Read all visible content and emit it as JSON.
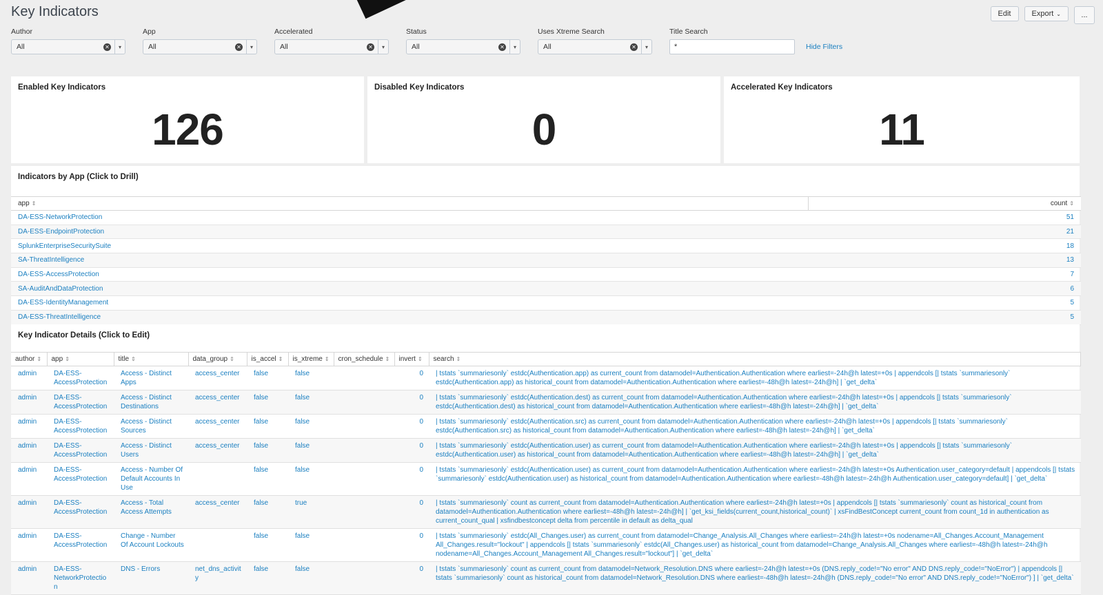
{
  "page": {
    "title": "Key Indicators",
    "actions": {
      "edit": "Edit",
      "export": "Export",
      "more": "..."
    }
  },
  "filters": {
    "author": {
      "label": "Author",
      "value": "All"
    },
    "app": {
      "label": "App",
      "value": "All"
    },
    "accelerated": {
      "label": "Accelerated",
      "value": "All"
    },
    "status": {
      "label": "Status",
      "value": "All"
    },
    "xtreme": {
      "label": "Uses Xtreme Search",
      "value": "All"
    },
    "title_search": {
      "label": "Title Search",
      "value": "*"
    },
    "hide_filters": "Hide Filters"
  },
  "singles": {
    "enabled": {
      "title": "Enabled Key Indicators",
      "value": "126"
    },
    "disabled": {
      "title": "Disabled Key Indicators",
      "value": "0"
    },
    "accelerated": {
      "title": "Accelerated Key Indicators",
      "value": "11"
    }
  },
  "by_app": {
    "title": "Indicators by App (Click to Drill)",
    "columns": [
      "app",
      "count"
    ],
    "rows": [
      {
        "app": "DA-ESS-NetworkProtection",
        "count": "51"
      },
      {
        "app": "DA-ESS-EndpointProtection",
        "count": "21"
      },
      {
        "app": "SplunkEnterpriseSecuritySuite",
        "count": "18"
      },
      {
        "app": "SA-ThreatIntelligence",
        "count": "13"
      },
      {
        "app": "DA-ESS-AccessProtection",
        "count": "7"
      },
      {
        "app": "SA-AuditAndDataProtection",
        "count": "6"
      },
      {
        "app": "DA-ESS-IdentityManagement",
        "count": "5"
      },
      {
        "app": "DA-ESS-ThreatIntelligence",
        "count": "5"
      }
    ]
  },
  "details": {
    "title": "Key Indicator Details (Click to Edit)",
    "columns": [
      "author",
      "app",
      "title",
      "data_group",
      "is_accel",
      "is_xtreme",
      "cron_schedule",
      "invert",
      "search"
    ],
    "rows": [
      {
        "author": "admin",
        "app": "DA-ESS-AccessProtection",
        "title": "Access - Distinct Apps",
        "data_group": "access_center",
        "is_accel": "false",
        "is_xtreme": "false",
        "cron_schedule": "",
        "invert": "0",
        "search": "| tstats `summariesonly` estdc(Authentication.app) as current_count from datamodel=Authentication.Authentication where earliest=-24h@h latest=+0s | appendcols [| tstats `summariesonly` estdc(Authentication.app) as historical_count from datamodel=Authentication.Authentication where earliest=-48h@h latest=-24h@h] | `get_delta`"
      },
      {
        "author": "admin",
        "app": "DA-ESS-AccessProtection",
        "title": "Access - Distinct Destinations",
        "data_group": "access_center",
        "is_accel": "false",
        "is_xtreme": "false",
        "cron_schedule": "",
        "invert": "0",
        "search": "| tstats `summariesonly` estdc(Authentication.dest) as current_count from datamodel=Authentication.Authentication where earliest=-24h@h latest=+0s | appendcols [| tstats `summariesonly` estdc(Authentication.dest) as historical_count from datamodel=Authentication.Authentication where earliest=-48h@h latest=-24h@h] | `get_delta`"
      },
      {
        "author": "admin",
        "app": "DA-ESS-AccessProtection",
        "title": "Access - Distinct Sources",
        "data_group": "access_center",
        "is_accel": "false",
        "is_xtreme": "false",
        "cron_schedule": "",
        "invert": "0",
        "search": "| tstats `summariesonly` estdc(Authentication.src) as current_count from datamodel=Authentication.Authentication where earliest=-24h@h latest=+0s | appendcols [| tstats `summariesonly` estdc(Authentication.src) as historical_count from datamodel=Authentication.Authentication where earliest=-48h@h latest=-24h@h] | `get_delta`"
      },
      {
        "author": "admin",
        "app": "DA-ESS-AccessProtection",
        "title": "Access - Distinct Users",
        "data_group": "access_center",
        "is_accel": "false",
        "is_xtreme": "false",
        "cron_schedule": "",
        "invert": "0",
        "search": "| tstats `summariesonly` estdc(Authentication.user) as current_count from datamodel=Authentication.Authentication where earliest=-24h@h latest=+0s | appendcols [| tstats `summariesonly` estdc(Authentication.user) as historical_count from datamodel=Authentication.Authentication where earliest=-48h@h latest=-24h@h] | `get_delta`"
      },
      {
        "author": "admin",
        "app": "DA-ESS-AccessProtection",
        "title": "Access - Number Of Default Accounts In Use",
        "data_group": "",
        "is_accel": "false",
        "is_xtreme": "false",
        "cron_schedule": "",
        "invert": "0",
        "search": "| tstats `summariesonly` estdc(Authentication.user) as current_count from datamodel=Authentication.Authentication where earliest=-24h@h latest=+0s Authentication.user_category=default | appendcols [| tstats `summariesonly` estdc(Authentication.user) as historical_count from datamodel=Authentication.Authentication where earliest=-48h@h latest=-24h@h Authentication.user_category=default] | `get_delta`"
      },
      {
        "author": "admin",
        "app": "DA-ESS-AccessProtection",
        "title": "Access - Total Access Attempts",
        "data_group": "access_center",
        "is_accel": "false",
        "is_xtreme": "true",
        "cron_schedule": "",
        "invert": "0",
        "search": "| tstats `summariesonly` count as current_count from datamodel=Authentication.Authentication where earliest=-24h@h latest=+0s | appendcols [| tstats `summariesonly` count as historical_count from datamodel=Authentication.Authentication where earliest=-48h@h latest=-24h@h] | `get_ksi_fields(current_count,historical_count)` | xsFindBestConcept current_count from count_1d in authentication as current_count_qual | xsfindbestconcept delta from percentile in default as delta_qual"
      },
      {
        "author": "admin",
        "app": "DA-ESS-AccessProtection",
        "title": "Change - Number Of Account Lockouts",
        "data_group": "",
        "is_accel": "false",
        "is_xtreme": "false",
        "cron_schedule": "",
        "invert": "0",
        "search": "| tstats `summariesonly` estdc(All_Changes.user) as current_count from datamodel=Change_Analysis.All_Changes where earliest=-24h@h latest=+0s nodename=All_Changes.Account_Management All_Changes.result=\"lockout\" | appendcols [| tstats `summariesonly` estdc(All_Changes.user) as historical_count from datamodel=Change_Analysis.All_Changes where earliest=-48h@h latest=-24h@h nodename=All_Changes.Account_Management All_Changes.result=\"lockout\"] | `get_delta`"
      },
      {
        "author": "admin",
        "app": "DA-ESS-NetworkProtection",
        "title": "DNS - Errors",
        "data_group": "net_dns_activity",
        "is_accel": "false",
        "is_xtreme": "false",
        "cron_schedule": "",
        "invert": "0",
        "search": "| tstats `summariesonly` count as current_count from datamodel=Network_Resolution.DNS where earliest=-24h@h latest=+0s (DNS.reply_code!=\"No error\" AND DNS.reply_code!=\"NoError\") | appendcols [| tstats `summariesonly` count as historical_count from datamodel=Network_Resolution.DNS where earliest=-48h@h latest=-24h@h (DNS.reply_code!=\"No error\" AND DNS.reply_code!=\"NoError\") ] | `get_delta`"
      }
    ]
  },
  "colors": {
    "link": "#1a7fc0",
    "background": "#eeeeee",
    "panel": "#ffffff"
  },
  "icons": {
    "clear": "clear-icon",
    "caret": "chevron-down-icon",
    "sort": "sort-icon"
  }
}
